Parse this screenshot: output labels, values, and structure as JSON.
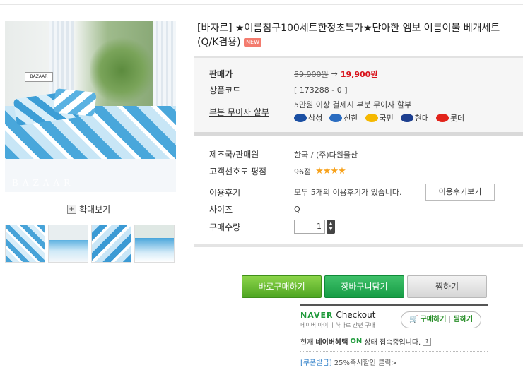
{
  "gallery": {
    "watermark": "BAZAAR",
    "sign_text": "BAZAAR",
    "zoom_label": "확대보기"
  },
  "product": {
    "title": "[바자르] ★여름침구100세트한정초특가★단아한 엠보 여름이불 베개세트 (Q/K겸용)",
    "new_badge": "NEW"
  },
  "price_box": {
    "price_label": "판매가",
    "original_price": "59,900원",
    "arrow": "→",
    "sale_price": "19,900원",
    "code_label": "상품코드",
    "code_value": "[ 173288 - 0 ]",
    "installment_label": "부분 무이자 할부",
    "installment_text": "5만원 이상 결제시 부분 무이자 할부",
    "cards": [
      {
        "name": "삼성",
        "color": "#1a4fa3"
      },
      {
        "name": "신한",
        "color": "#2a6cc0"
      },
      {
        "name": "국민",
        "color": "#f5b800"
      },
      {
        "name": "현대",
        "color": "#1d3f8f"
      },
      {
        "name": "롯데",
        "color": "#e2231a"
      }
    ]
  },
  "info": {
    "maker_label": "제조국/판매원",
    "maker_value": "한국 / (주)다원물산",
    "rating_label": "고객선호도 평점",
    "rating_value": "96점",
    "rating_stars": 4,
    "review_label": "이용후기",
    "review_text": "모두 5개의 이용후기가 있습니다.",
    "review_button": "이용후기보기",
    "size_label": "사이즈",
    "size_value": "Q",
    "qty_label": "구매수량",
    "qty_value": "1"
  },
  "actions": {
    "buy": "바로구매하기",
    "cart": "장바구니담기",
    "wish": "찜하기"
  },
  "naver": {
    "brand": "NAVER",
    "checkout": "Checkout",
    "sub": "네이버 아이디 하나로 간편 구매",
    "buy_label": "구매하기",
    "wish_label": "찜하기",
    "status_prefix": "현재",
    "status_brand": "네이버혜택",
    "status_on": "ON",
    "status_suffix": "상태 접속중입니다.",
    "help": "?",
    "coupon_tag": "[쿠폰발급]",
    "coupon_text": "25%즉시할인 클릭>"
  }
}
